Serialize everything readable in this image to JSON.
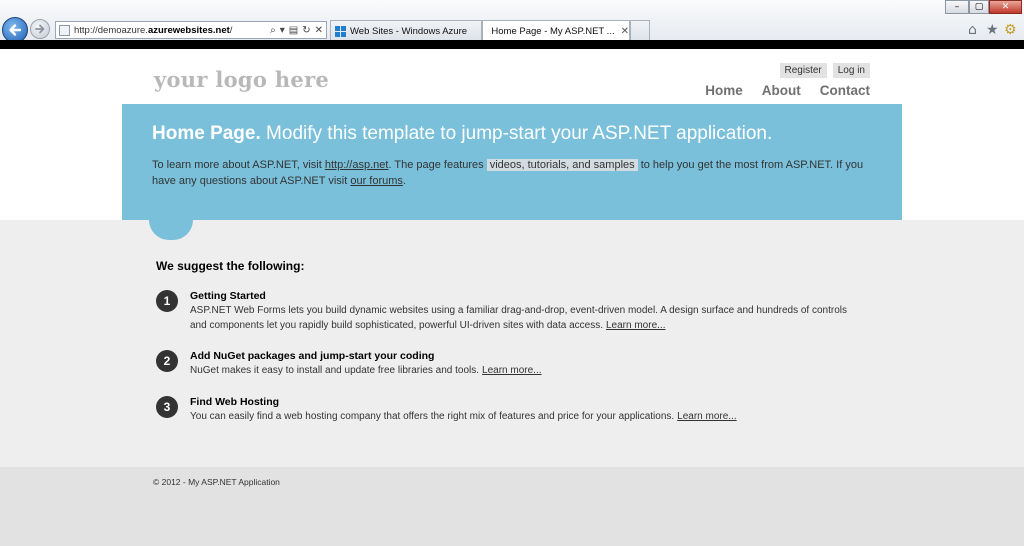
{
  "browser": {
    "url_prefix": "http://demoazure.",
    "url_domain": "azurewebsites.net",
    "url_suffix": "/",
    "tabs": [
      {
        "label": "Web Sites - Windows Azure",
        "active": false
      },
      {
        "label": "Home Page - My ASP.NET ...",
        "active": true
      }
    ],
    "tab_close_glyph": "✕",
    "window_controls": {
      "minimize": "–",
      "maximize": "▢",
      "close": "✕"
    },
    "icons": {
      "back": "arrow-left-icon",
      "forward": "arrow-right-icon",
      "home": "home-icon",
      "favorites": "star-icon",
      "tools": "gear-icon"
    }
  },
  "header": {
    "logo": "your logo here",
    "register": "Register",
    "login": "Log in",
    "nav": [
      "Home",
      "About",
      "Contact"
    ]
  },
  "featured": {
    "title_strong": "Home Page.",
    "title_rest": "Modify this template to jump-start your ASP.NET application.",
    "text_1": "To learn more about ASP.NET, visit",
    "link_asp": "http://asp.net",
    "text_2": ". The page features",
    "link_videos": "videos, tutorials, and samples",
    "text_3": "to help you get the most from ASP.NET. If you have any questions about ASP.NET visit",
    "link_forums": "our forums",
    "text_4": "."
  },
  "suggest": {
    "title": "We suggest the following:",
    "learn_more": "Learn more...",
    "steps": [
      {
        "num": "1",
        "title": "Getting Started",
        "text": "ASP.NET Web Forms lets you build dynamic websites using a familiar drag-and-drop, event-driven model. A design surface and hundreds of controls and components let you rapidly build sophisticated, powerful UI-driven sites with data access."
      },
      {
        "num": "2",
        "title": "Add NuGet packages and jump-start your coding",
        "text": "NuGet makes it easy to install and update free libraries and tools."
      },
      {
        "num": "3",
        "title": "Find Web Hosting",
        "text": "You can easily find a web hosting company that offers the right mix of features and price for your applications."
      }
    ]
  },
  "footer": {
    "copyright": "© 2012 - My ASP.NET Application"
  },
  "colors": {
    "featured_bg": "#7ac0da",
    "body_bg": "#efeeef",
    "footer_bg": "#e2e2e2"
  }
}
